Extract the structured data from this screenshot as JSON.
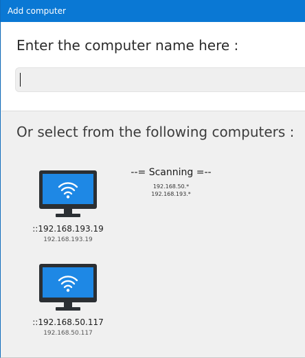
{
  "window": {
    "title": "Add computer"
  },
  "entry": {
    "prompt": "Enter the computer name here :",
    "input_value": ""
  },
  "selection": {
    "label": "Or select from the following computers :"
  },
  "computers": [
    {
      "name": "::192.168.193.19",
      "ip": "192.168.193.19",
      "icon": "monitor-wifi-icon"
    },
    {
      "name": "::192.168.50.117",
      "ip": "192.168.50.117",
      "icon": "monitor-wifi-icon"
    }
  ],
  "scanning": {
    "title": "--= Scanning =--",
    "ranges": [
      "192.168.50.*",
      "192.168.193.*"
    ]
  },
  "colors": {
    "titlebar": "#0a78d4",
    "monitor_frame": "#2b2f33",
    "monitor_screen": "#1e88e5",
    "background": "#f0f0f0"
  }
}
